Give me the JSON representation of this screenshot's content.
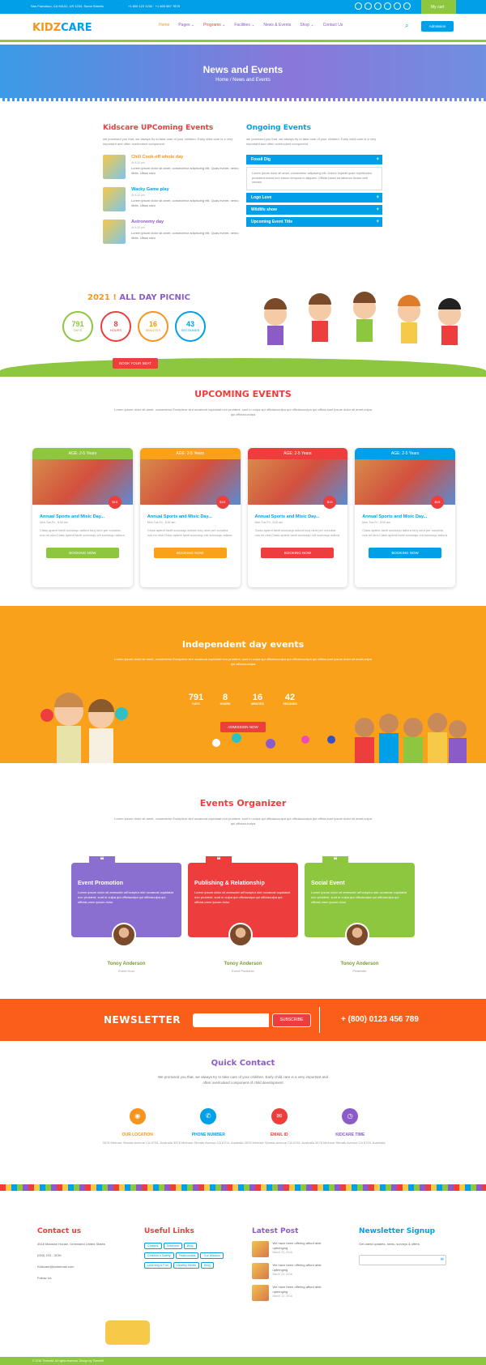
{
  "topbar": {
    "address": "San Francisco, CA 94102, US 1234, Some Streets",
    "phone": "+1 800 123 1234 · +1 800 567 7878",
    "cart": "My cart"
  },
  "nav": {
    "logo_a": "KIDZ",
    "logo_b": "CARE",
    "items": [
      "Home",
      "Pages ⌄",
      "Programs ⌄",
      "Facilities ⌄",
      "News & Events",
      "Shop ⌄",
      "Contact Us"
    ],
    "admission": "Admission",
    "search_icon": "search-icon"
  },
  "banner": {
    "title": "News and Events",
    "crumb": "Home / News and Events"
  },
  "kidscare": {
    "title": "Kidscare UPComing Events",
    "desc": "we promised you that, we always try to take care of your children. Early child care is a very important and often overlooked component",
    "events": [
      {
        "title": "Chili Cook-off whole day",
        "time": "At 6:30 pm",
        "text": "Lorem ipsum dolor sit amet, consectetur adipiscing elit. Quas everet, nemo dicta. Ullam nam"
      },
      {
        "title": "Wacky Game play",
        "time": "At 6:30 pm",
        "text": "Lorem ipsum dolor sit amet, consectetur adipiscing elit. Quas everet, nemo dicta. Ullam nam"
      },
      {
        "title": "Astronomy day",
        "time": "At 6:30 pm",
        "text": "Lorem ipsum dolor sit amet, consectetur adipiscing elit. Quas everet, nemo dicta. Ullam nam"
      }
    ]
  },
  "ongoing": {
    "title": "Ongoing Events",
    "desc": "we promised you that, we always try to take care of your children. Early child care is a very important and often overlooked component",
    "acc": [
      {
        "head": "Fossil Dig",
        "body": "Lorem ipsum dolor sit amet, consectetur adipiscing elit. Dolore impedit quae repellendus provident dolore iure earum tempora in aliquam. Officiis totam ea laborum dicam velit veniam"
      },
      {
        "head": "Logo Love"
      },
      {
        "head": "Wildlife show"
      },
      {
        "head": "Upcoming Event Title"
      }
    ]
  },
  "picnic": {
    "year": "2021 !",
    "title": "ALL DAY PICNIC",
    "counts": [
      {
        "n": "791",
        "l": "DAYS",
        "c": "#8dc63f"
      },
      {
        "n": "8",
        "l": "HOURS",
        "c": "#ee3d3d"
      },
      {
        "n": "16",
        "l": "MINUTES",
        "c": "#f7941d"
      },
      {
        "n": "43",
        "l": "SECOUNDS",
        "c": "#00a0e9"
      }
    ],
    "button": "BOOK YOUR SEAT"
  },
  "upcoming": {
    "title": "UPCOMING EVENTS",
    "desc": "Lorem ipsum dolor sit amet, consectetur Excepteur sint occaecat cupidatat non proident, sunt in culpa qui officiacuculpa qui officiacuculpa qui officia,sunt ipsum dolor sit amet,culpa qui officiacuculpa",
    "cards": [
      {
        "age": "AGE: 2-5 Years",
        "price": "$15",
        "title": "Annual Sports and Misic Day...",
        "date": "Mon-Tue-Fri , 8:00 am",
        "text": "Class aptent taciti sociosqu adiora torq uent per conubia nos mi nira.Class aptent taciti sociosqu crit sociosqu adiora",
        "btn": "BOOKING NOW",
        "color": "#8dc63f"
      },
      {
        "age": "AGE: 2-5 Years",
        "price": "$15",
        "title": "Annual Sports and Misic Day...",
        "date": "Mon-Tue-Fri , 8:00 am",
        "text": "Class aptent taciti sociosqu adiora torq uent per conubia nos mi nira.Class aptent taciti sociosqu crit sociosqu adiora",
        "btn": "BOOKING NOW",
        "color": "#faa11c"
      },
      {
        "age": "AGE: 2-5 Years",
        "price": "$15",
        "title": "Annual Sports and Misic Day...",
        "date": "Mon-Tue-Fri , 8:00 am",
        "text": "Class aptent taciti sociosqu adiora torq uent per conubia nos mi nira.Class aptent taciti sociosqu crit sociosqu adiora",
        "btn": "BOOKING NOW",
        "color": "#ee3d3d"
      },
      {
        "age": "AGE: 2-5 Years",
        "price": "$15",
        "title": "Annual Sports and Misic Day...",
        "date": "Mon-Tue-Fri , 8:00 am",
        "text": "Class aptent taciti sociosqu adiora torq uent per conubia nos mi nira.Class aptent taciti sociosqu crit sociosqu adiora",
        "btn": "BOOKING NOW",
        "color": "#00a0e9"
      }
    ]
  },
  "independent": {
    "title": "Independent day events",
    "desc": "Lorem ipsum dolor sit amet, consectetur Excepteur sint occaecat cupidatat non proident, sunt in culpa qui officiacuculpa qui officiacuculpa qui officia,sunt ipsum dolor sit amet,culpa qui officiacuculpa",
    "counts": [
      {
        "n": "791",
        "l": "DAYS"
      },
      {
        "n": "8",
        "l": "HOURS"
      },
      {
        "n": "16",
        "l": "MINUTES"
      },
      {
        "n": "42",
        "l": "SECONDS"
      }
    ],
    "button": "ADMISSION NOW"
  },
  "organizer": {
    "title": "Events Organizer",
    "desc": "Lorem ipsum dolor sit amet, consectetur Excepteur sint occaecat cupidatat non proident, sunt in culpa qui officiacuculpa qui officiacuculpa qui officia,sunt ipsum dolor sit amet,culpa qui officiacuculpa",
    "items": [
      {
        "title": "Event Promotion",
        "text": "Lorem ipsum dolor sit amesctet urExceptur sint occaecat cupidatat non proident, sunt in culpa qui officiaculpa qui officiaculpa qui official,orem ipsum dolor",
        "name": "Tonoy Anderson",
        "role": "Event Host",
        "color": "#8b6fd0"
      },
      {
        "title": "Publishing & Relationship",
        "text": "Lorem ipsum dolor sit amesctet urExceptur sint occaecat cupidatat non proident, sunt in culpa qui officiaculpa qui officiaculpa qui official,orem ipsum dolor",
        "name": "Tonoy Anderson",
        "role": "Event Publisher",
        "color": "#ee3d3d"
      },
      {
        "title": "Social Event",
        "text": "Lorem ipsum dolor sit amesctet urExceptur sint occaecat cupidatat non proident, sunt in culpa qui officiaculpa qui officiaculpa qui official,orem ipsum dolor",
        "name": "Tonoy Anderson",
        "role": "Presenter",
        "color": "#8dc63f"
      }
    ]
  },
  "newsletter": {
    "title": "NEWSLETTER",
    "button": "SUBSCRIBE",
    "phone": "+ (800) 0123 456 789"
  },
  "quick": {
    "title": "Quick Contact",
    "desc": "We promised you that, we always try to take care of your children. Early child care is a very important and often overlooked component of child development",
    "items": [
      {
        "h": "OUR LOCATION",
        "p": "3576 Melrose Streats Avenue CA 8704, Australia",
        "c": "#f7941d",
        "i": "◉"
      },
      {
        "h": "PHONE NUMBER",
        "p": "3576 Melrose Streats Avenue CA 8704, Australia",
        "c": "#00a0e9",
        "i": "✆"
      },
      {
        "h": "EMAIL ID",
        "p": "3576 Melrose Streats Avenue CA 8704, Australia",
        "c": "#ee3d3d",
        "i": "✉"
      },
      {
        "h": "KIDCARE TIME",
        "p": "3576 Melrose Streats Avenue CA 8704, Australia",
        "c": "#8b5cc8",
        "i": "◷"
      }
    ]
  },
  "footer": {
    "contact_title": "Contact us",
    "address": "4518 Mansion House, Greenland United States",
    "phone": "(000) 233 - 3236",
    "email": "Kidscare@somemail.com",
    "follow": "Follow Us",
    "links_title": "Useful Links",
    "links": [
      "Classes",
      "Teachers",
      "Blog",
      "Children's Safety",
      "Testimonials",
      "Our Mission",
      "Learning & Fun",
      "Healthy Meals",
      "Blog"
    ],
    "post_title": "Latest Post",
    "posts": [
      {
        "t": "We have been offering afford able upbringing",
        "d": "March 23, 2016"
      },
      {
        "t": "We have been offering afford able upbringing",
        "d": "March 23, 2016"
      },
      {
        "t": "We have been offering afford able upbringing",
        "d": "March 23, 2016"
      }
    ],
    "signup_title": "Newsletter Signup",
    "signup_text": "Get latest updates, news, surveys & offers",
    "copyright": "© 2016 ThemeM. All rights reserved. Design by ThemeM"
  }
}
